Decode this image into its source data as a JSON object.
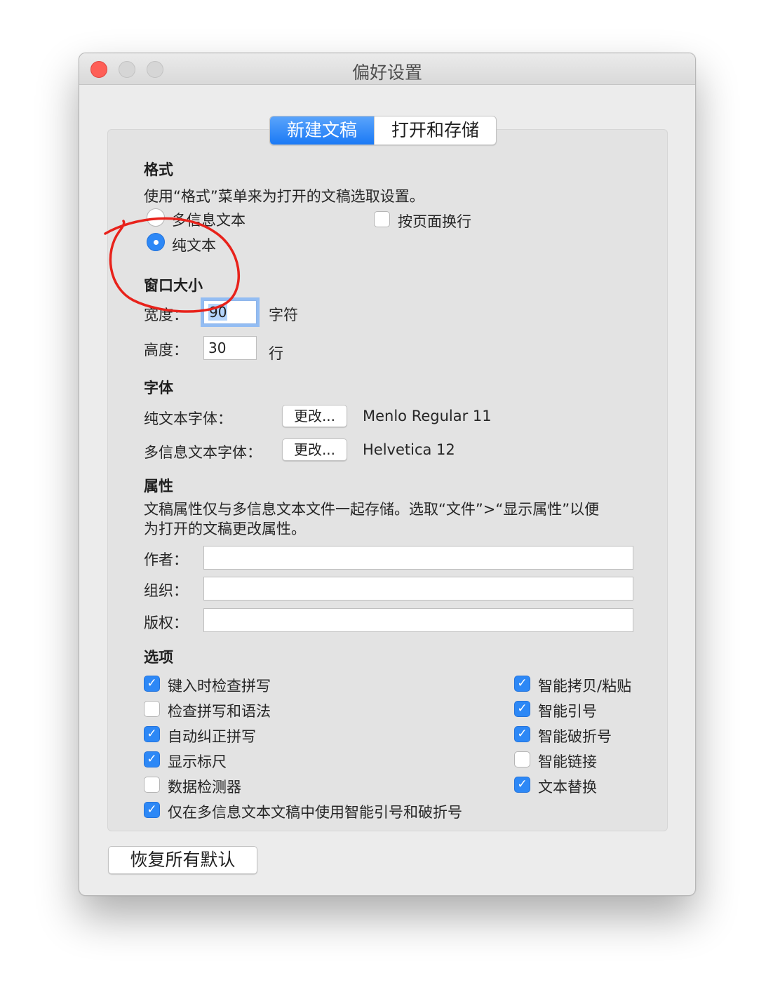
{
  "window": {
    "title": "偏好设置"
  },
  "tabs": [
    {
      "label": "新建文稿",
      "active": true
    },
    {
      "label": "打开和存储",
      "active": false
    }
  ],
  "format": {
    "heading": "格式",
    "description": "使用“格式”菜单来为打开的文稿选取设置。",
    "rich_text_label": "多信息文本",
    "plain_text_label": "纯文本",
    "selected": "纯文本",
    "wrap_label": "按页面换行",
    "wrap_checked": false
  },
  "window_size": {
    "heading": "窗口大小",
    "width_label": "宽度：",
    "width_value": "90",
    "width_unit": "字符",
    "height_label": "高度：",
    "height_value": "30",
    "height_unit": "行"
  },
  "font": {
    "heading": "字体",
    "plain_label": "纯文本字体：",
    "plain_button": "更改...",
    "plain_value": "Menlo Regular 11",
    "rich_label": "多信息文本字体：",
    "rich_button": "更改...",
    "rich_value": "Helvetica 12"
  },
  "properties": {
    "heading": "属性",
    "description_line1": "文稿属性仅与多信息文本文件一起存储。选取“文件”>“显示属性”以便",
    "description_line2": "为打开的文稿更改属性。",
    "author_label": "作者：",
    "author_value": "",
    "organization_label": "组织：",
    "organization_value": "",
    "copyright_label": "版权：",
    "copyright_value": ""
  },
  "options": {
    "heading": "选项",
    "left": [
      {
        "label": "键入时检查拼写",
        "checked": true
      },
      {
        "label": "检查拼写和语法",
        "checked": false
      },
      {
        "label": "自动纠正拼写",
        "checked": true
      },
      {
        "label": "显示标尺",
        "checked": true
      },
      {
        "label": "数据检测器",
        "checked": false
      }
    ],
    "right": [
      {
        "label": "智能拷贝/粘贴",
        "checked": true
      },
      {
        "label": "智能引号",
        "checked": true
      },
      {
        "label": "智能破折号",
        "checked": true
      },
      {
        "label": "智能链接",
        "checked": false
      },
      {
        "label": "文本替换",
        "checked": true
      }
    ],
    "bottom": {
      "label": "仅在多信息文本文稿中使用智能引号和破折号",
      "checked": true
    },
    "check_glyph": "✓"
  },
  "restore_button": "恢复所有默认",
  "annotation": {
    "color": "#e8221b",
    "shape": "hand-drawn-circle",
    "around": "纯文本"
  }
}
